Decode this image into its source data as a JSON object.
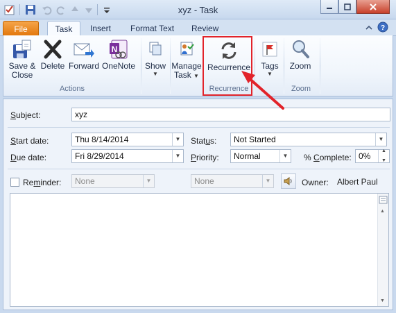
{
  "window": {
    "title": "xyz  -  Task"
  },
  "tabs": [
    {
      "label": "File"
    },
    {
      "label": "Task"
    },
    {
      "label": "Insert"
    },
    {
      "label": "Format Text"
    },
    {
      "label": "Review"
    }
  ],
  "ribbon": {
    "actions": {
      "save_close_line1": "Save &",
      "save_close_line2": "Close",
      "delete": "Delete",
      "forward": "Forward",
      "onenote": "OneNote",
      "group": "Actions"
    },
    "show": {
      "label": "Show"
    },
    "manage": {
      "line1": "Manage",
      "line2": "Task"
    },
    "recurrence": {
      "label": "Recurrence",
      "group": "Recurrence"
    },
    "tags": {
      "label": "Tags"
    },
    "zoom": {
      "label": "Zoom",
      "group": "Zoom"
    }
  },
  "form": {
    "subject_label": "Subject:",
    "subject_value": "xyz",
    "start_label": "Start date:",
    "start_value": "Thu 8/14/2014",
    "due_label": "Due date:",
    "due_value": "Fri 8/29/2014",
    "status_label": "Status:",
    "status_value": "Not Started",
    "priority_label": "Priority:",
    "priority_value": "Normal",
    "complete_label": "% Complete:",
    "complete_value": "0%",
    "reminder_label": "Reminder:",
    "reminder_date": "None",
    "reminder_time": "None",
    "owner_label": "Owner:",
    "owner_value": "Albert Paul"
  }
}
